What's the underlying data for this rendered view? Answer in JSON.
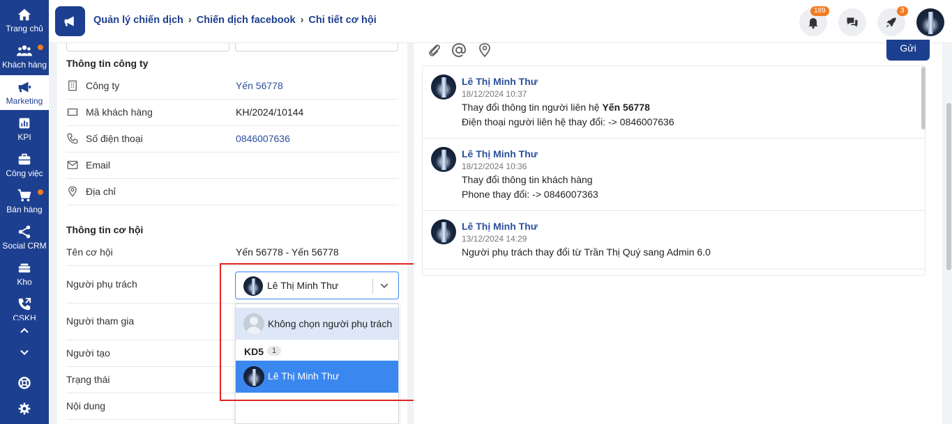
{
  "sidebar": {
    "items": [
      {
        "label": "Trang chủ",
        "icon": "home-icon"
      },
      {
        "label": "Khách hàng",
        "icon": "customers-icon"
      },
      {
        "label": "Marketing",
        "icon": "megaphone-icon"
      },
      {
        "label": "KPI",
        "icon": "chart-icon"
      },
      {
        "label": "Công việc",
        "icon": "briefcase-icon"
      },
      {
        "label": "Bán hàng",
        "icon": "cart-icon"
      },
      {
        "label": "Social CRM",
        "icon": "share-icon"
      },
      {
        "label": "Kho",
        "icon": "warehouse-icon"
      },
      {
        "label": "CSKH",
        "icon": "phone-icon"
      }
    ]
  },
  "header": {
    "breadcrumb": [
      "Quản lý chiến dịch",
      "Chiến dịch facebook",
      "Chi tiết cơ hội"
    ],
    "notification_count": "189",
    "rocket_count": "3"
  },
  "company_section": {
    "title": "Thông tin công ty",
    "rows": [
      {
        "label": "Công ty",
        "value": "Yến 56778"
      },
      {
        "label": "Mã khách hàng",
        "value": "KH/2024/10144"
      },
      {
        "label": "Số điện thoại",
        "value": "0846007636"
      },
      {
        "label": "Email",
        "value": ""
      },
      {
        "label": "Địa chỉ",
        "value": ""
      }
    ]
  },
  "opportunity_section": {
    "title": "Thông tin cơ hội",
    "rows": [
      {
        "label": "Tên cơ hội",
        "value": "Yến 56778 - Yến 56778"
      },
      {
        "label": "Người phụ trách",
        "value": ""
      },
      {
        "label": "Người tham gia",
        "value": ""
      },
      {
        "label": "Người tạo",
        "value": ""
      },
      {
        "label": "Trạng thái",
        "value": ""
      },
      {
        "label": "Nội dung",
        "value": ""
      }
    ]
  },
  "owner_select": {
    "selected": "Lê Thị Minh Thư",
    "options": {
      "none_label": "Không chọn người phụ trách",
      "group_name": "KD5",
      "group_count": "1",
      "member": "Lê Thị Minh Thư"
    }
  },
  "comment_toolbar": {
    "send_label": "Gửi"
  },
  "activity_feed": [
    {
      "name": "Lê Thị Minh Thư",
      "time": "18/12/2024 10:37",
      "line1_prefix": "Thay đổi thông tin người liên hệ ",
      "line1_bold": "Yến 56778",
      "line2": "Điện thoại người liên hệ thay đổi: -> 0846007636"
    },
    {
      "name": "Lê Thị Minh Thư",
      "time": "18/12/2024 10:36",
      "line1_prefix": "Thay đổi thông tin khách hàng",
      "line1_bold": "",
      "line2": "Phone thay đổi: -> 0846007363"
    },
    {
      "name": "Lê Thị Minh Thư",
      "time": "13/12/2024 14:29",
      "line1_prefix": "Người phụ trách thay đổi từ Trần Thị Quý sang Admin 6.0",
      "line1_bold": "",
      "line2": ""
    }
  ],
  "colors": {
    "sidebar": "#1d3f8f",
    "accent": "#3b87f0",
    "badge": "#f27b21",
    "highlight_box": "#e02424"
  }
}
